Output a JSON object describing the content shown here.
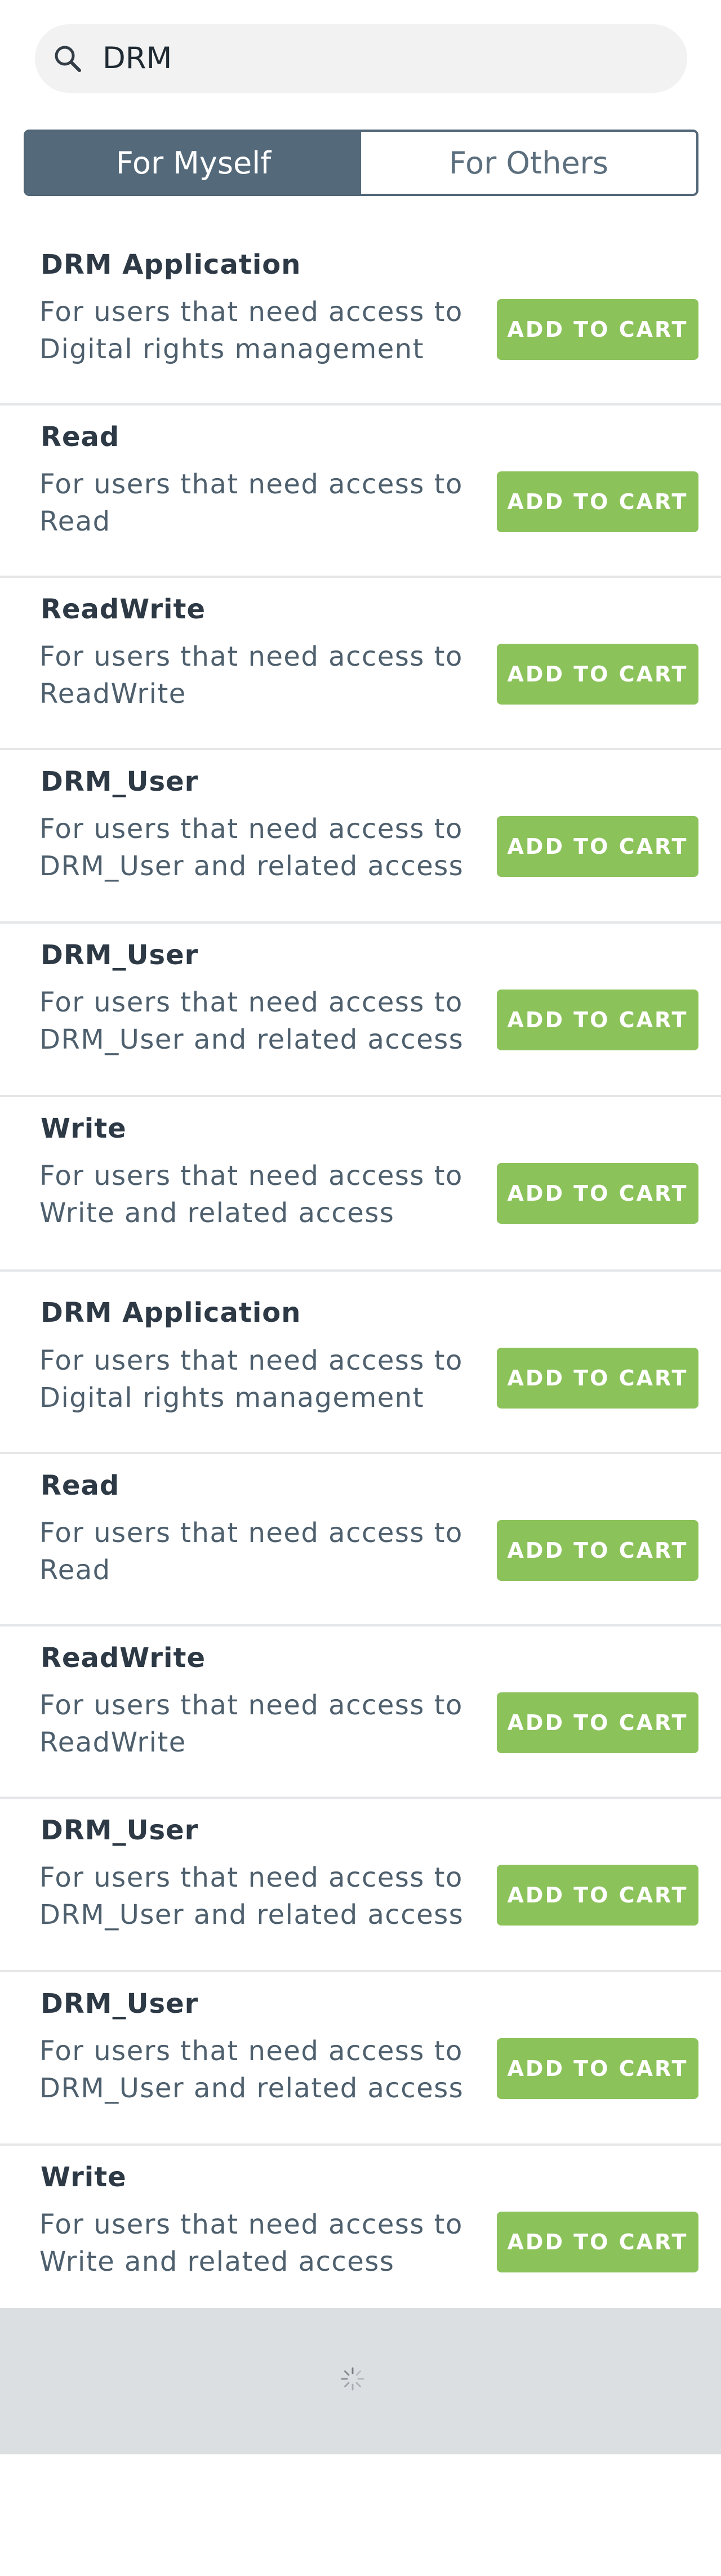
{
  "search": {
    "query": "DRM"
  },
  "toggle": {
    "myself": "For Myself",
    "others": "For Others"
  },
  "items": [
    {
      "title": "DRM Application",
      "line1": "For users that need access to",
      "line2": "Digital rights management",
      "button": "ADD TO CART"
    },
    {
      "title": "Read",
      "line1": "For users that need access to",
      "line2": "Read",
      "button": "ADD TO CART"
    },
    {
      "title": "ReadWrite",
      "line1": "For users that need access to",
      "line2": "ReadWrite",
      "button": "ADD TO CART"
    },
    {
      "title": "DRM_User",
      "line1": "For users that need access to",
      "line2": "DRM_User and related access",
      "button": "ADD TO CART"
    },
    {
      "title": "DRM_User",
      "line1": "For users that need access to",
      "line2": "DRM_User and related access",
      "button": "ADD TO CART"
    },
    {
      "title": "Write",
      "line1": "For users that need access to",
      "line2": "Write and related access",
      "button": "ADD TO CART"
    },
    {
      "title": "DRM Application",
      "line1": "For users that need access to",
      "line2": "Digital rights management",
      "button": "ADD TO CART"
    },
    {
      "title": "Read",
      "line1": "For users that need access to",
      "line2": "Read",
      "button": "ADD TO CART"
    },
    {
      "title": "ReadWrite",
      "line1": "For users that need access to",
      "line2": "ReadWrite",
      "button": "ADD TO CART"
    },
    {
      "title": "DRM_User",
      "line1": "For users that need access to",
      "line2": "DRM_User and related access",
      "button": "ADD TO CART"
    },
    {
      "title": "DRM_User",
      "line1": "For users that need access to",
      "line2": "DRM_User and related access",
      "button": "ADD TO CART"
    },
    {
      "title": "Write",
      "line1": "For users that need access to",
      "line2": "Write and related access",
      "button": "ADD TO CART"
    }
  ],
  "colors": {
    "accent": "#8bc25a",
    "toggle_active": "#546a7b"
  },
  "icons": {
    "search": "search-icon",
    "loading": "spinner-icon"
  }
}
